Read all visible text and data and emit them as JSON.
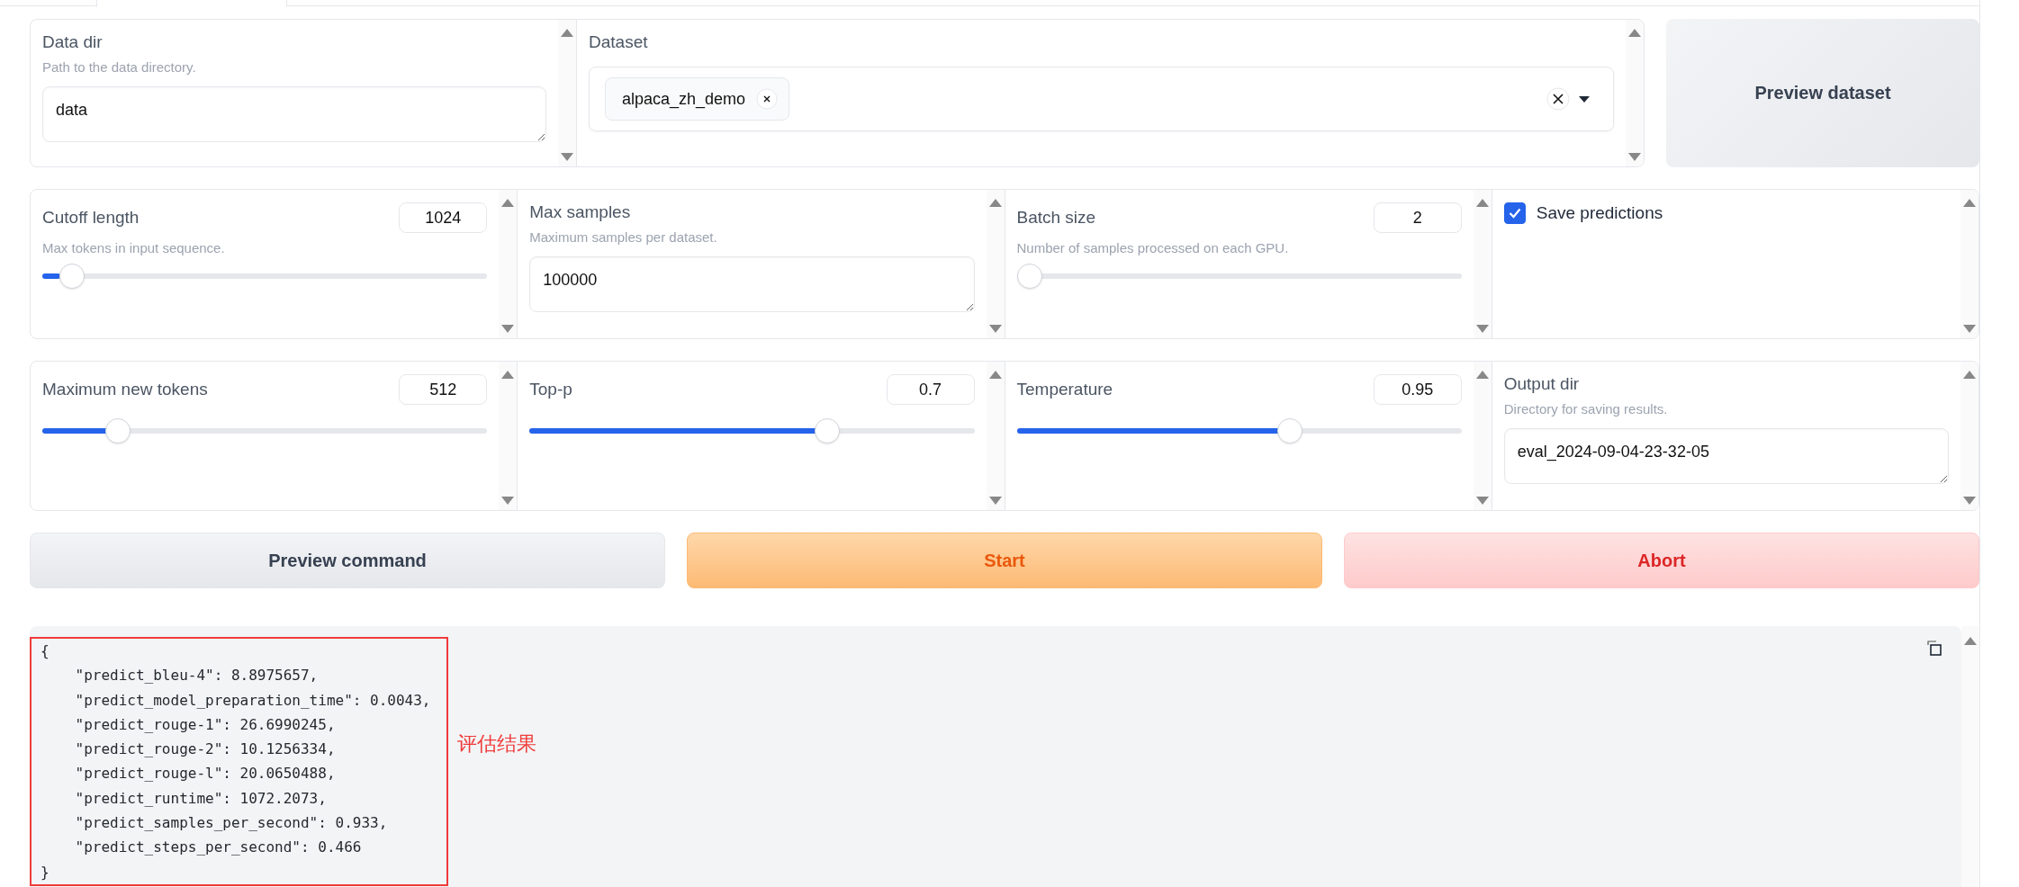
{
  "dataset_row": {
    "data_dir": {
      "label": "Data dir",
      "info": "Path to the data directory.",
      "value": "data"
    },
    "dataset": {
      "label": "Dataset",
      "tags": [
        "alpaca_zh_demo"
      ]
    },
    "preview_button": "Preview dataset"
  },
  "settings_rows": [
    [
      {
        "kind": "slider",
        "label": "Cutoff length",
        "info": "Max tokens in input sequence.",
        "value": "1024",
        "level": 0.04
      },
      {
        "kind": "textbox",
        "label": "Max samples",
        "info": "Maximum samples per dataset.",
        "value": "100000"
      },
      {
        "kind": "slider",
        "label": "Batch size",
        "info": "Number of samples processed on each GPU.",
        "value": "2",
        "level": 0
      },
      {
        "kind": "checkbox",
        "label": "Save predictions",
        "checked": true
      }
    ],
    [
      {
        "kind": "slider",
        "label": "Maximum new tokens",
        "value": "512",
        "level": 0.15
      },
      {
        "kind": "slider",
        "label": "Top-p",
        "value": "0.7",
        "level": 0.68
      },
      {
        "kind": "slider",
        "label": "Temperature",
        "value": "0.95",
        "level": 0.62
      },
      {
        "kind": "textbox",
        "label": "Output dir",
        "info": "Directory for saving results.",
        "value": "eval_2024-09-04-23-32-05"
      }
    ]
  ],
  "actions": [
    {
      "kind": "secondary",
      "label": "Preview command"
    },
    {
      "kind": "primary",
      "label": "Start"
    },
    {
      "kind": "stop",
      "label": "Abort"
    }
  ],
  "output": {
    "text": "{\n    \"predict_bleu-4\": 8.8975657,\n    \"predict_model_preparation_time\": 0.0043,\n    \"predict_rouge-1\": 26.6990245,\n    \"predict_rouge-2\": 10.1256334,\n    \"predict_rouge-l\": 20.0650488,\n    \"predict_runtime\": 1072.2073,\n    \"predict_samples_per_second\": 0.933,\n    \"predict_steps_per_second\": 0.466\n}",
    "annotation": "评估结果"
  }
}
